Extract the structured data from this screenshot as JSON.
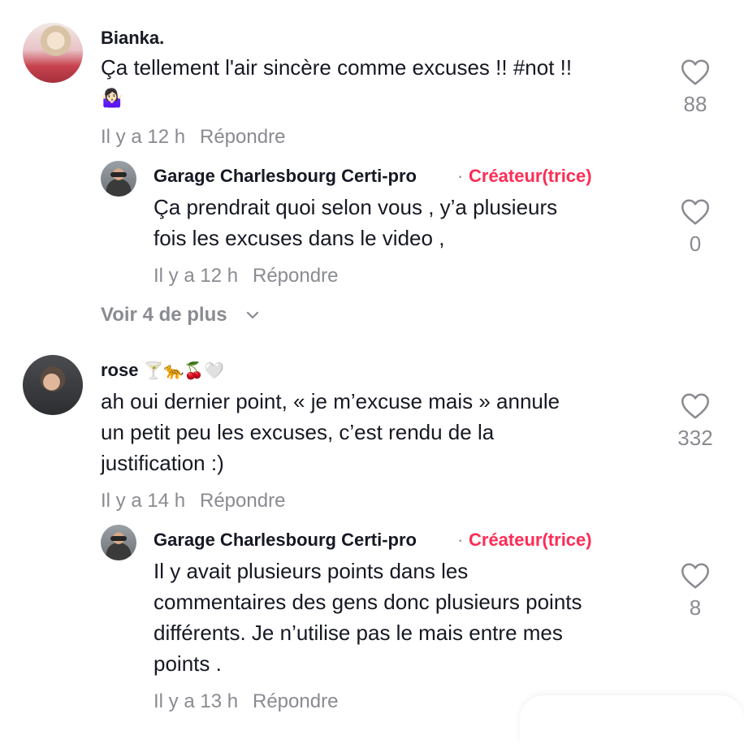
{
  "comments": [
    {
      "username": "Bianka.",
      "text_lines": [
        "Ça tellement l'air sincère comme excuses !! #not !!",
        "🤷🏻‍♀️"
      ],
      "time": "Il y a 12 h",
      "reply_label": "Répondre",
      "likes": "88",
      "reply": {
        "username": "Garage Charlesbourg Certi-pro",
        "separator": "·",
        "badge": "Créateur(trice)",
        "text_lines": [
          "Ça prendrait quoi selon vous , y’a plusieurs",
          "fois les excuses dans le video ,"
        ],
        "time": "Il y a 12 h",
        "reply_label": "Répondre",
        "likes": "0"
      },
      "more_label": "Voir 4 de plus"
    },
    {
      "username": "rose",
      "username_emoji": "🍸🐆🍒🤍",
      "text_lines": [
        "ah oui dernier point, « je m’excuse mais » annule",
        "un petit peu les excuses, c’est rendu de la",
        "justification :)"
      ],
      "time": "Il y a 14 h",
      "reply_label": "Répondre",
      "likes": "332",
      "reply": {
        "username": "Garage Charlesbourg Certi-pro",
        "separator": "·",
        "badge": "Créateur(trice)",
        "text_lines": [
          "Il y avait plusieurs points dans les",
          "commentaires des gens donc plusieurs points",
          "différents. Je n’utilise pas le mais entre mes",
          "points ."
        ],
        "time": "Il y a 13 h",
        "reply_label": "Répondre",
        "likes": "8"
      }
    }
  ],
  "icons": {
    "like": "heart-outline-icon",
    "more": "chevron-down-icon"
  },
  "colors": {
    "text": "#161823",
    "muted": "#8a8b91",
    "creator": "#fe2c55"
  }
}
